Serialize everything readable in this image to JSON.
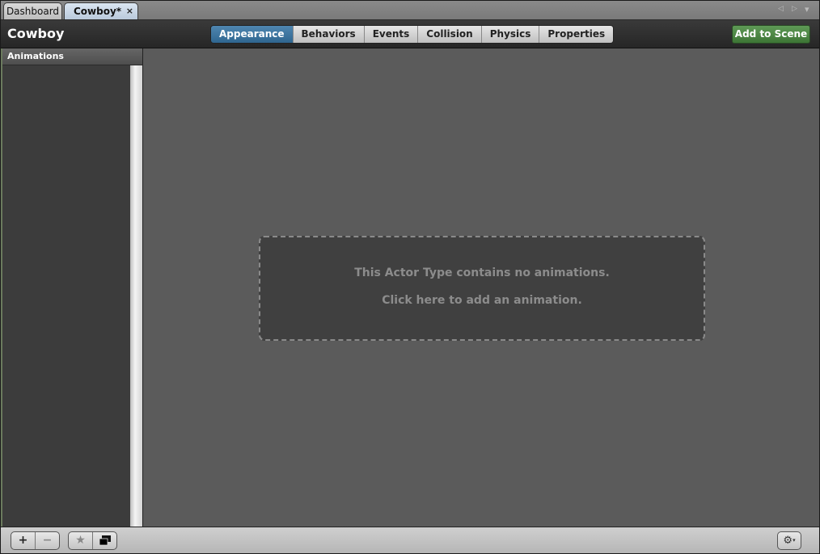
{
  "tabs": [
    {
      "label": "Dashboard",
      "active": false
    },
    {
      "label": "Cowboy*",
      "active": true,
      "close": "×"
    }
  ],
  "tab_nav": {
    "prev": "◁",
    "next": "▷",
    "menu": "▾"
  },
  "header": {
    "title": "Cowboy",
    "segments": [
      "Appearance",
      "Behaviors",
      "Events",
      "Collision",
      "Physics",
      "Properties"
    ],
    "active_segment": "Appearance",
    "add_to_scene": "Add to Scene"
  },
  "sidebar": {
    "heading": "Animations"
  },
  "main": {
    "empty_line1": "This Actor Type contains no animations.",
    "empty_line2": "Click here to add an animation."
  },
  "footer": {
    "add": "+",
    "remove": "−",
    "favorite": "★",
    "gear": "⚙",
    "gear_caret": "▾"
  },
  "colors": {
    "active_tab": "#3b719b",
    "add_to_scene": "#4a8440"
  }
}
